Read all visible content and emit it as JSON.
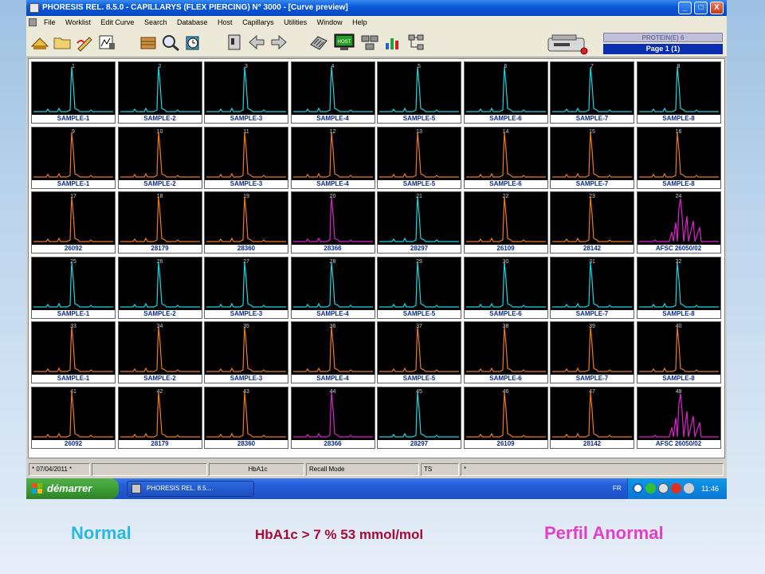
{
  "window": {
    "title": "PHORESIS REL. 8.5.0 - CAPILLARYS (FLEX PIERCING) N° 3000 - [Curve preview]",
    "buttons": [
      "_",
      "□",
      "X"
    ]
  },
  "menu": {
    "items": [
      "File",
      "Worklist",
      "Edit Curve",
      "Search",
      "Database",
      "Host",
      "Capillarys",
      "Utilities",
      "Window",
      "Help"
    ]
  },
  "toolbar": {
    "icons": [
      "scale-icon",
      "folder-icon",
      "pen-icon",
      "edit-curve-icon",
      "archive-icon",
      "search-icon",
      "clock-icon",
      "machine-icon",
      "arrow-left-icon",
      "arrow-right-icon",
      "keyboard-icon",
      "host-icon",
      "network-icon",
      "chart-icon",
      "tree-icon"
    ],
    "host_label": "HOST",
    "profile": "PROTEIN(E) 6",
    "page": "Page 1 (1)"
  },
  "colors": {
    "normal": "#19d7e6",
    "sample": "#f07a1e",
    "abnormal": "#e020d0",
    "label": "#0a2a8a"
  },
  "samples": [
    {
      "num": "1",
      "label": "SAMPLE-1",
      "type": "normal"
    },
    {
      "num": "2",
      "label": "SAMPLE-2",
      "type": "normal"
    },
    {
      "num": "3",
      "label": "SAMPLE-3",
      "type": "normal"
    },
    {
      "num": "4",
      "label": "SAMPLE-4",
      "type": "normal"
    },
    {
      "num": "5",
      "label": "SAMPLE-5",
      "type": "normal"
    },
    {
      "num": "6",
      "label": "SAMPLE-6",
      "type": "normal"
    },
    {
      "num": "7",
      "label": "SAMPLE-7",
      "type": "normal"
    },
    {
      "num": "8",
      "label": "SAMPLE-8",
      "type": "normal"
    },
    {
      "num": "9",
      "label": "SAMPLE-1",
      "type": "sample"
    },
    {
      "num": "10",
      "label": "SAMPLE-2",
      "type": "sample"
    },
    {
      "num": "11",
      "label": "SAMPLE-3",
      "type": "sample"
    },
    {
      "num": "12",
      "label": "SAMPLE-4",
      "type": "sample"
    },
    {
      "num": "13",
      "label": "SAMPLE-5",
      "type": "sample"
    },
    {
      "num": "14",
      "label": "SAMPLE-6",
      "type": "sample"
    },
    {
      "num": "15",
      "label": "SAMPLE-7",
      "type": "sample"
    },
    {
      "num": "16",
      "label": "SAMPLE-8",
      "type": "sample"
    },
    {
      "num": "17",
      "label": "26092",
      "type": "sample"
    },
    {
      "num": "18",
      "label": "28179",
      "type": "sample"
    },
    {
      "num": "19",
      "label": "28360",
      "type": "sample"
    },
    {
      "num": "20",
      "label": "28366",
      "type": "abnormal"
    },
    {
      "num": "21",
      "label": "28297",
      "type": "normal"
    },
    {
      "num": "22",
      "label": "26109",
      "type": "sample"
    },
    {
      "num": "23",
      "label": "28142",
      "type": "sample"
    },
    {
      "num": "24",
      "label": "AFSC 26050/02",
      "type": "multi"
    },
    {
      "num": "25",
      "label": "SAMPLE-1",
      "type": "normal"
    },
    {
      "num": "26",
      "label": "SAMPLE-2",
      "type": "normal"
    },
    {
      "num": "27",
      "label": "SAMPLE-3",
      "type": "normal"
    },
    {
      "num": "28",
      "label": "SAMPLE-4",
      "type": "normal"
    },
    {
      "num": "29",
      "label": "SAMPLE-5",
      "type": "normal"
    },
    {
      "num": "30",
      "label": "SAMPLE-6",
      "type": "normal"
    },
    {
      "num": "31",
      "label": "SAMPLE-7",
      "type": "normal"
    },
    {
      "num": "32",
      "label": "SAMPLE-8",
      "type": "normal"
    },
    {
      "num": "33",
      "label": "SAMPLE-1",
      "type": "sample"
    },
    {
      "num": "34",
      "label": "SAMPLE-2",
      "type": "sample"
    },
    {
      "num": "35",
      "label": "SAMPLE-3",
      "type": "sample"
    },
    {
      "num": "36",
      "label": "SAMPLE-4",
      "type": "sample"
    },
    {
      "num": "37",
      "label": "SAMPLE-5",
      "type": "sample"
    },
    {
      "num": "38",
      "label": "SAMPLE-6",
      "type": "sample"
    },
    {
      "num": "39",
      "label": "SAMPLE-7",
      "type": "sample"
    },
    {
      "num": "40",
      "label": "SAMPLE-8",
      "type": "sample"
    },
    {
      "num": "41",
      "label": "26092",
      "type": "sample"
    },
    {
      "num": "42",
      "label": "28179",
      "type": "sample"
    },
    {
      "num": "43",
      "label": "28360",
      "type": "sample"
    },
    {
      "num": "44",
      "label": "28366",
      "type": "abnormal"
    },
    {
      "num": "45",
      "label": "28297",
      "type": "normal"
    },
    {
      "num": "46",
      "label": "26109",
      "type": "sample"
    },
    {
      "num": "47",
      "label": "28142",
      "type": "sample"
    },
    {
      "num": "48",
      "label": "AFSC 26050/02",
      "type": "multi"
    }
  ],
  "statusbar": {
    "date": "* 07/04/2011 *",
    "test": "HbA1c",
    "mode": "Recall Mode",
    "ts": "TS",
    "star": "*"
  },
  "taskbar": {
    "start": "démarrer",
    "task": "PHORESIS REL. 8.5....",
    "lang": "FR",
    "clock": "11:46"
  },
  "captions": {
    "normal": "Normal",
    "hba1c": "HbA1c  > 7 % 53 mmol/mol",
    "abnormal": "Perfil Anormal"
  }
}
